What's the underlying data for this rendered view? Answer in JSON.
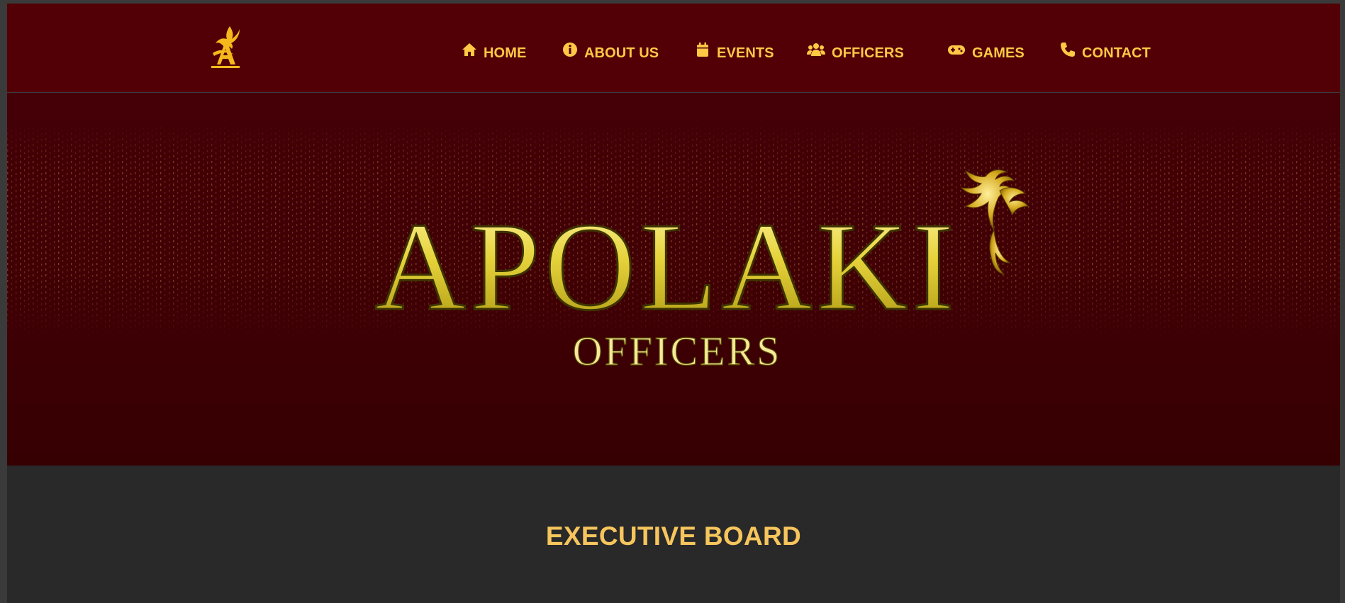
{
  "site": {
    "logo_icon": "phoenix-a-logo-icon",
    "brand_color": "#ffc845",
    "nav_background": "#520005"
  },
  "nav": {
    "items": [
      {
        "label": "HOME",
        "icon": "home-icon"
      },
      {
        "label": "ABOUT US",
        "icon": "info-circle-icon"
      },
      {
        "label": "EVENTS",
        "icon": "calendar-icon"
      },
      {
        "label": "OFFICERS",
        "icon": "users-icon"
      },
      {
        "label": "GAMES",
        "icon": "gamepad-icon"
      },
      {
        "label": "CONTACT",
        "icon": "phone-icon"
      }
    ]
  },
  "hero": {
    "title": "APOLAKI",
    "subtitle": "OFFICERS",
    "emblem_icon": "golden-phoenix-icon"
  },
  "content": {
    "section_title": "EXECUTIVE BOARD"
  }
}
